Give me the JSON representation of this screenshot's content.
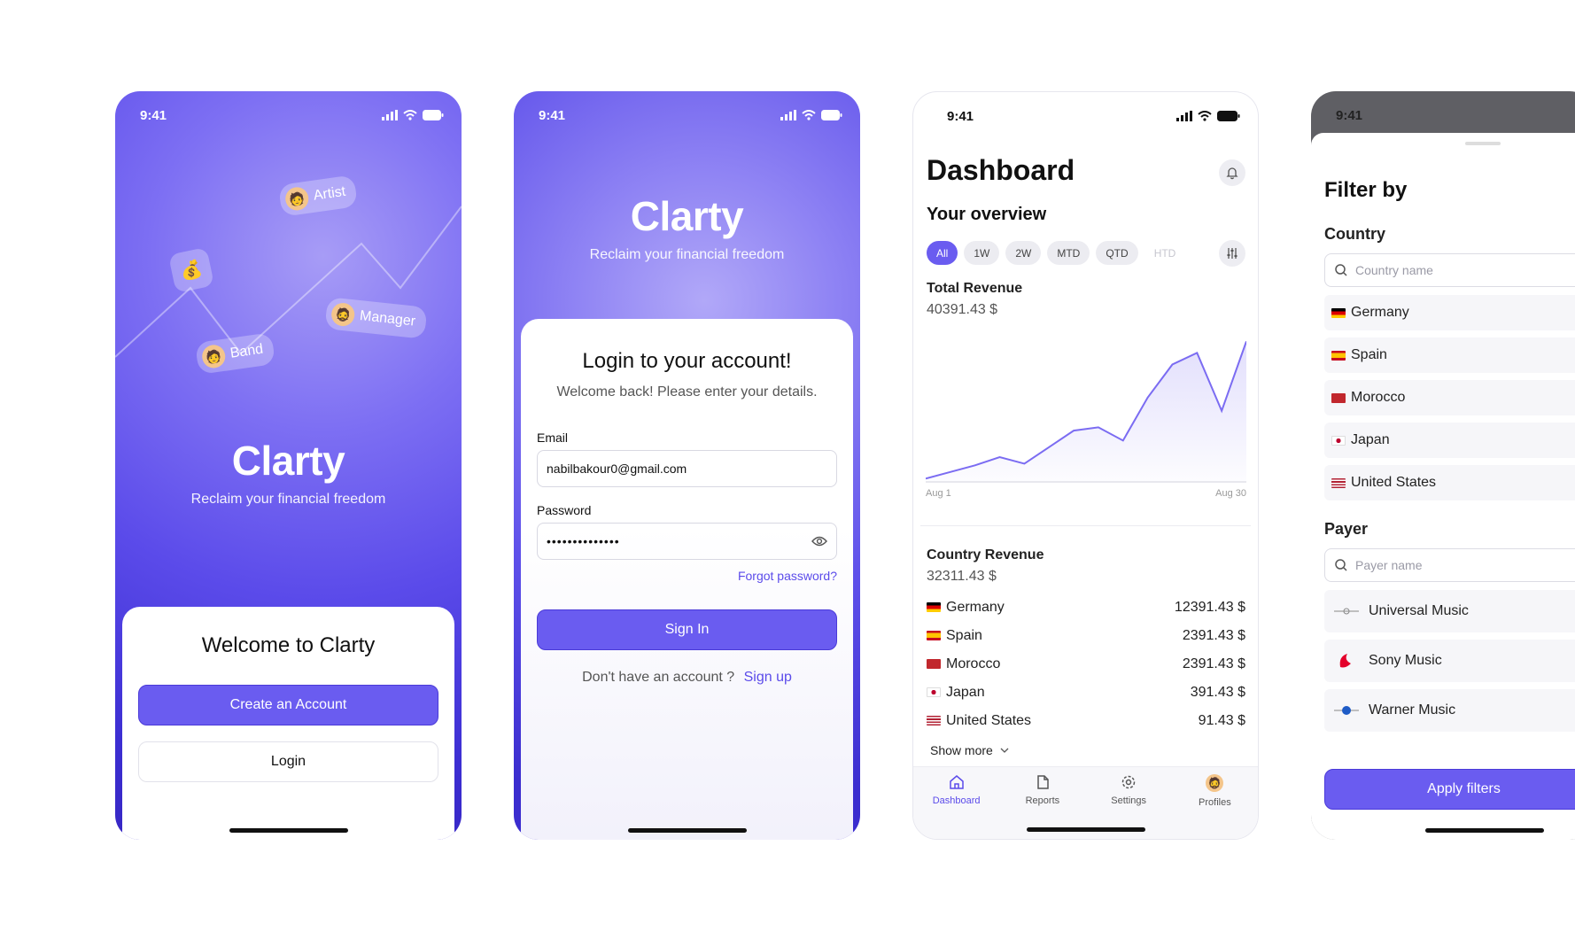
{
  "status": {
    "time": "9:41"
  },
  "welcome_screen": {
    "chips": {
      "artist": "Artist",
      "manager": "Manager",
      "band": "Band"
    },
    "brand": "Clarty",
    "tagline": "Reclaim your financial freedom",
    "card_title": "Welcome to Clarty",
    "create_label": "Create an Account",
    "login_label": "Login"
  },
  "login_screen": {
    "brand": "Clarty",
    "tagline": "Reclaim your financial freedom",
    "title": "Login to your account!",
    "subtitle": "Welcome back! Please enter your details.",
    "email_label": "Email",
    "email_value": "nabilbakour0@gmail.com",
    "password_label": "Password",
    "password_value": "••••••••••••••",
    "forgot_label": "Forgot password?",
    "signin_label": "Sign In",
    "no_account": "Don't have an account ?",
    "signup_label": "Sign up"
  },
  "dashboard": {
    "title": "Dashboard",
    "overview": "Your overview",
    "filters": [
      "All",
      "1W",
      "2W",
      "MTD",
      "QTD",
      "HTD"
    ],
    "total_revenue_label": "Total Revenue",
    "total_revenue_value": "40391.43 $",
    "country_revenue_label": "Country Revenue",
    "country_revenue_value": "32311.43 $",
    "countries": [
      {
        "name": "Germany",
        "value": "12391.43 $"
      },
      {
        "name": "Spain",
        "value": "2391.43 $"
      },
      {
        "name": "Morocco",
        "value": "2391.43 $"
      },
      {
        "name": "Japan",
        "value": "391.43 $"
      },
      {
        "name": "United States",
        "value": "91.43 $"
      }
    ],
    "show_more": "Show more",
    "tabs": [
      "Dashboard",
      "Reports",
      "Settings",
      "Profiles"
    ]
  },
  "chart_data": {
    "type": "area",
    "x": [
      "Aug 1",
      "",
      "",
      "",
      "",
      "",
      "",
      "",
      "",
      "",
      "",
      "",
      "",
      "",
      "",
      "",
      "",
      "",
      "",
      "",
      "",
      "",
      "",
      "",
      "",
      "",
      "",
      "",
      "",
      "Aug 30"
    ],
    "x_tick_labels": [
      "Aug 1",
      "Aug 30"
    ],
    "values": [
      2,
      6,
      10,
      15,
      11,
      21,
      31,
      33,
      25,
      51,
      71,
      78,
      43,
      85
    ],
    "title": "",
    "xlabel": "",
    "ylabel": "",
    "grid": false,
    "color": "#7b6cf2"
  },
  "filter_sheet": {
    "title": "Filter by",
    "country_label": "Country",
    "country_placeholder": "Country name",
    "countries": [
      "Germany",
      "Spain",
      "Morocco",
      "Japan",
      "United States"
    ],
    "payer_label": "Payer",
    "payer_placeholder": "Payer name",
    "payers": [
      "Universal Music",
      "Sony Music",
      "Warner Music"
    ],
    "apply_label": "Apply filters"
  },
  "colors": {
    "accent": "#6a5cf0",
    "accent_dark": "#4a3ad8"
  }
}
